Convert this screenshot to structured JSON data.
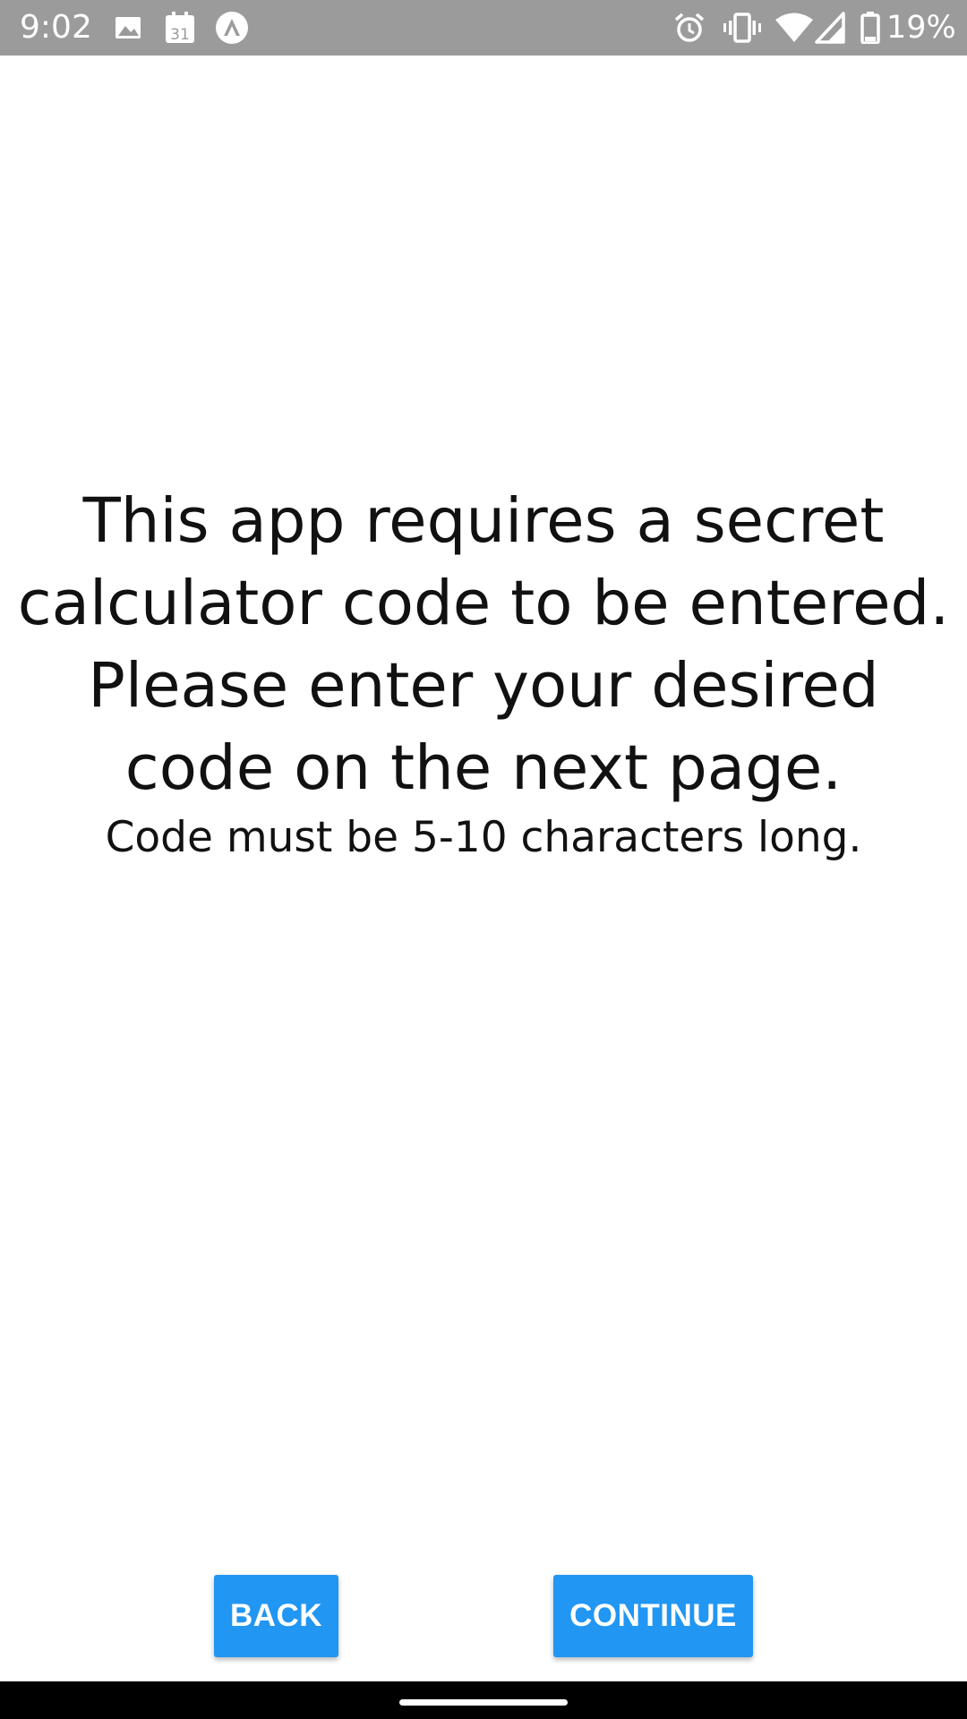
{
  "status_bar": {
    "time": "9:02",
    "battery_percent": "19%",
    "calendar_day": "31",
    "icons": [
      "image-icon",
      "calendar-icon",
      "nav-arrow-icon",
      "alarm-icon",
      "vibrate-icon",
      "wifi-icon",
      "signal-icon",
      "battery-icon"
    ],
    "background": "#9b9b9b"
  },
  "main": {
    "headline": "This app requires a secret calculator code to be entered. Please enter your desired code on the next page.",
    "subline": "Code must be 5-10 characters long."
  },
  "buttons": {
    "back_label": "BACK",
    "continue_label": "CONTINUE",
    "color": "#2196f3"
  },
  "nav_bar": {
    "home_indicator": "home-pill"
  }
}
